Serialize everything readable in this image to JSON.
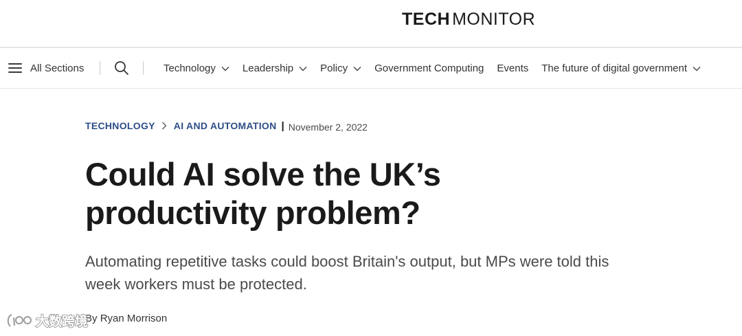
{
  "brand": {
    "logo_bold": "TECH",
    "logo_light": "MONITOR"
  },
  "nav": {
    "menu_label": "All Sections",
    "items": [
      {
        "label": "Technology",
        "has_dropdown": true
      },
      {
        "label": "Leadership",
        "has_dropdown": true
      },
      {
        "label": "Policy",
        "has_dropdown": true
      },
      {
        "label": "Government Computing",
        "has_dropdown": false
      },
      {
        "label": "Events",
        "has_dropdown": false
      },
      {
        "label": "The future of digital government",
        "has_dropdown": true
      }
    ]
  },
  "article": {
    "breadcrumb": [
      "TECHNOLOGY",
      "AI AND AUTOMATION"
    ],
    "date": "November 2, 2022",
    "headline": "Could AI solve the UK’s productivity problem?",
    "standfirst": "Automating repetitive tasks could boost Britain's output, but MPs were told this week workers must be protected.",
    "byline_prefix": "By",
    "author": "Ryan Morrison"
  },
  "watermark": {
    "text": "大数跨境"
  },
  "colors": {
    "accent": "#2d4e87",
    "text": "#1a1a1a",
    "muted": "#4a4a4a",
    "divider": "#e6e6e6"
  },
  "icons": [
    "hamburger-icon",
    "search-icon",
    "chevron-down-icon",
    "chevron-right-icon",
    "watermark-logo-icon"
  ]
}
